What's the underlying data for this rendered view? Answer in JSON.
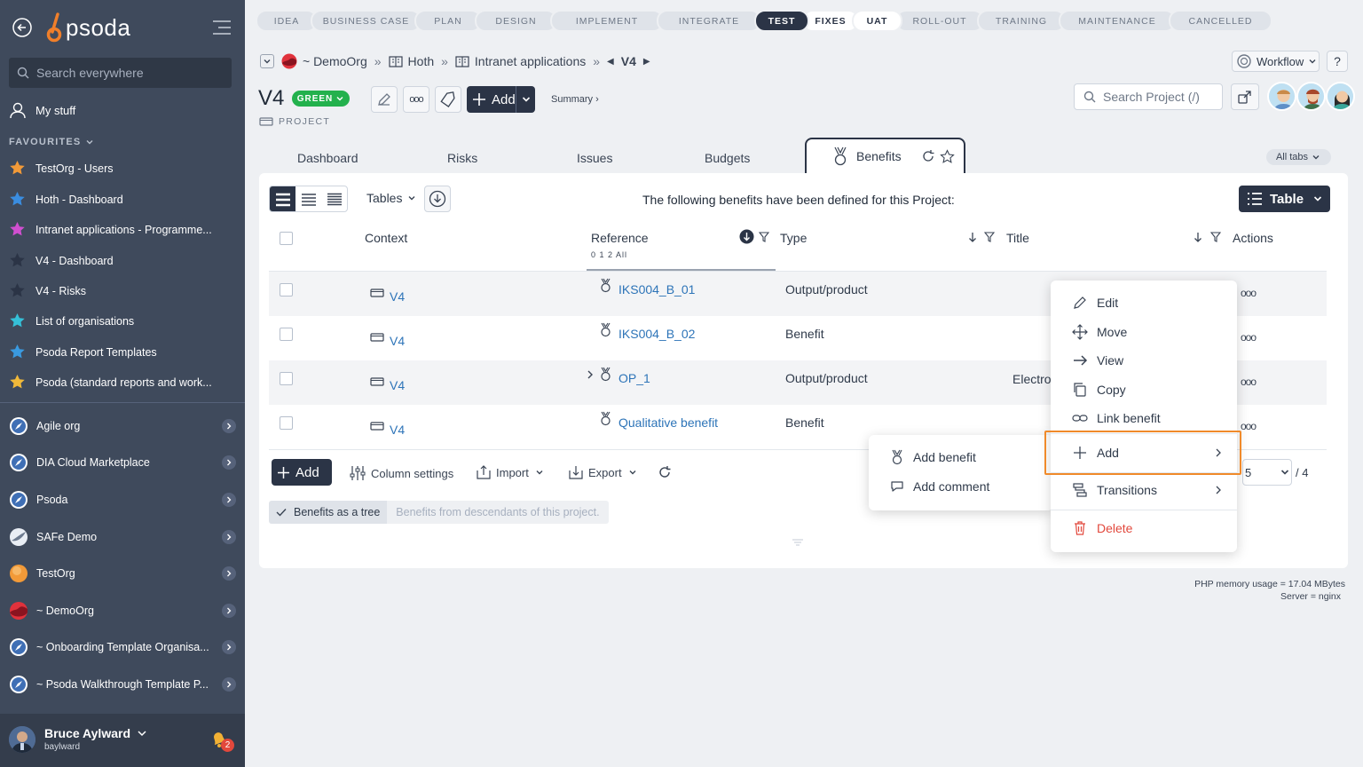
{
  "sidebar": {
    "logo": "psoda",
    "search_placeholder": "Search everywhere",
    "my_stuff": "My stuff",
    "favourites_header": "FAVOURITES",
    "favourites": [
      {
        "label": "TestOrg - Users",
        "color": "#f29a38"
      },
      {
        "label": "Hoth - Dashboard",
        "color": "#3a8de0"
      },
      {
        "label": "Intranet applications - Programme...",
        "color": "#d04fd0"
      },
      {
        "label": "V4 - Dashboard",
        "color": "#2b3446"
      },
      {
        "label": "V4 - Risks",
        "color": "#2b3446"
      },
      {
        "label": "List of organisations",
        "color": "#35c0d8"
      },
      {
        "label": "Psoda Report Templates",
        "color": "#3a9ae0"
      },
      {
        "label": "Psoda (standard reports and work...",
        "color": "#f0b93a"
      }
    ],
    "orgs": [
      {
        "label": "Agile org"
      },
      {
        "label": "DIA Cloud Marketplace"
      },
      {
        "label": "Psoda"
      },
      {
        "label": "SAFe Demo"
      },
      {
        "label": "TestOrg"
      },
      {
        "label": "~ DemoOrg"
      },
      {
        "label": "~ Onboarding Template Organisa..."
      },
      {
        "label": "~ Psoda Walkthrough Template P..."
      }
    ],
    "user": {
      "name": "Bruce Aylward",
      "login": "baylward",
      "notifications": "2"
    }
  },
  "stages": [
    "IDEA",
    "BUSINESS CASE",
    "PLAN",
    "DESIGN",
    "IMPLEMENT",
    "INTEGRATE",
    "TEST",
    "FIXES",
    "UAT",
    "ROLL-OUT",
    "TRAINING",
    "MAINTENANCE",
    "CANCELLED"
  ],
  "stage_active": "TEST",
  "breadcrumb": {
    "org": "~ DemoOrg",
    "programme": "Hoth",
    "portfolio": "Intranet applications",
    "current": "V4"
  },
  "workflow_label": "Workflow",
  "help_label": "?",
  "project": {
    "title": "V4",
    "status": "GREEN",
    "type": "PROJECT",
    "add_label": "Add",
    "summary_label": "Summary ›"
  },
  "search_project_placeholder": "Search Project (/)",
  "tabs": {
    "dashboard": "Dashboard",
    "risks": "Risks",
    "issues": "Issues",
    "budgets": "Budgets",
    "benefits": "Benefits",
    "all_tabs": "All tabs"
  },
  "toolbar": {
    "tables_label": "Tables",
    "intro": "The following benefits have been defined for this Project:",
    "table_view_label": "Table"
  },
  "table": {
    "headers": {
      "context": "Context",
      "reference": "Reference",
      "reference_sub": "0 1 2 All",
      "type": "Type",
      "title": "Title",
      "actions": "Actions"
    },
    "rows": [
      {
        "context": "V4",
        "reference": "IKS004_B_01",
        "type": "Output/product",
        "title": "",
        "actions": "ooo"
      },
      {
        "context": "V4",
        "reference": "IKS004_B_02",
        "type": "Benefit",
        "title": "",
        "actions": "ooo"
      },
      {
        "context": "V4",
        "reference": "OP_1",
        "type": "Output/product",
        "title": "Electro",
        "actions": "ooo"
      },
      {
        "context": "V4",
        "reference": "Qualitative benefit",
        "type": "Benefit",
        "title": "",
        "actions": "ooo"
      }
    ]
  },
  "footer_tools": {
    "add": "Add",
    "column_settings": "Column settings",
    "import": "Import",
    "export": "Export",
    "page_size": "5",
    "page_total": "/ 4"
  },
  "tree_toggle": {
    "on": "Benefits as a tree",
    "off": "Benefits from descendants of this project."
  },
  "action_menu": {
    "edit": "Edit",
    "move": "Move",
    "view": "View",
    "copy": "Copy",
    "link": "Link benefit",
    "add": "Add",
    "transitions": "Transitions",
    "delete": "Delete"
  },
  "add_submenu": {
    "add_benefit": "Add benefit",
    "add_comment": "Add comment"
  },
  "footer": {
    "memory": "PHP memory usage = 17.04 MBytes",
    "server": "Server = nginx"
  }
}
